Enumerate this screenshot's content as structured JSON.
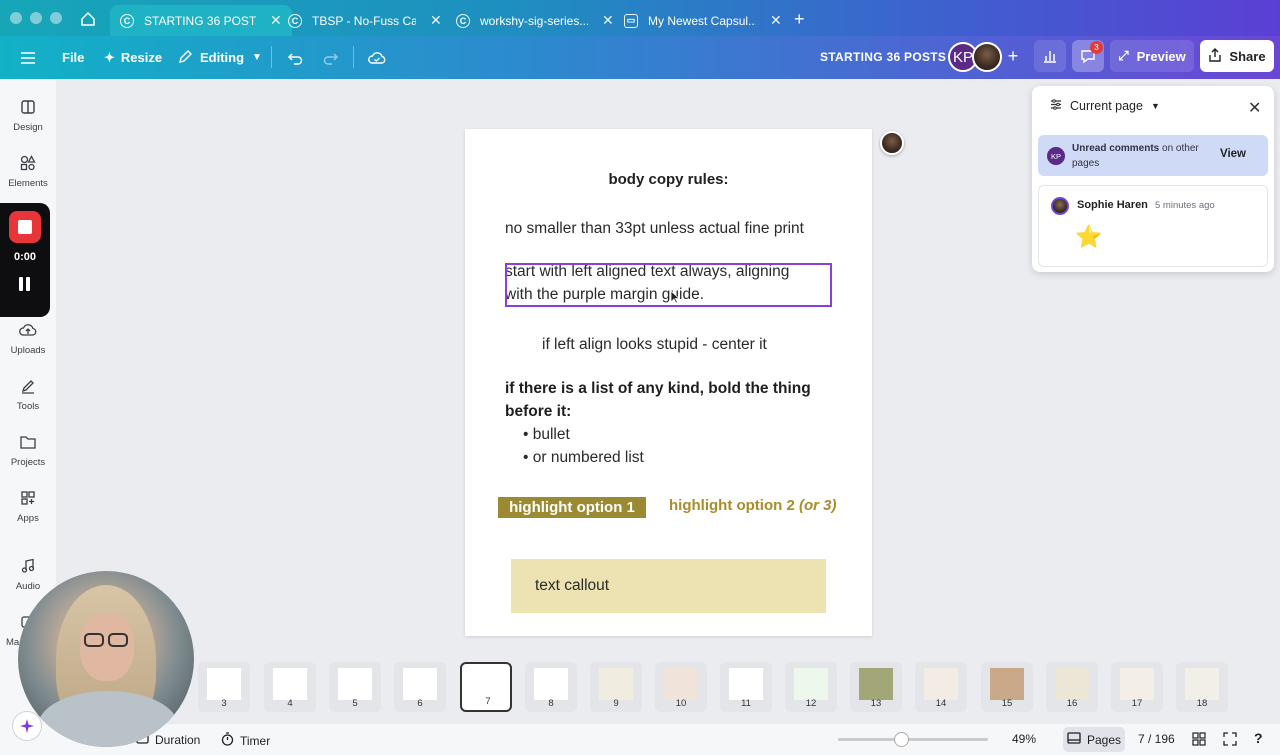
{
  "tabs": [
    {
      "label": "STARTING 36 POST...",
      "icon": "canva-icon"
    },
    {
      "label": "TBSP - No-Fuss Ca...",
      "icon": "canva-icon"
    },
    {
      "label": "workshy-sig-series...",
      "icon": "canva-icon"
    },
    {
      "label": "My Newest Capsul...",
      "icon": "chat-icon"
    }
  ],
  "toolbar": {
    "file_label": "File",
    "resize_label": "Resize",
    "editing_label": "Editing",
    "doc_title": "STARTING 36 POSTS",
    "avatar_initials": "KP",
    "comments_badge": "3",
    "preview_label": "Preview",
    "share_label": "Share"
  },
  "sidebar": {
    "items": [
      {
        "label": "Design",
        "icon": "design-icon"
      },
      {
        "label": "Elements",
        "icon": "elements-icon"
      },
      {
        "label": "Uploads",
        "icon": "uploads-icon"
      },
      {
        "label": "Tools",
        "icon": "tools-icon"
      },
      {
        "label": "Projects",
        "icon": "projects-icon"
      },
      {
        "label": "Apps",
        "icon": "apps-icon"
      },
      {
        "label": "Audio",
        "icon": "audio-icon"
      },
      {
        "label": "Ma",
        "icon": "magic-icon"
      }
    ]
  },
  "recorder": {
    "time": "0:00"
  },
  "page": {
    "heading": "body copy rules:",
    "line1": "no smaller than 33pt unless actual fine print",
    "line2a": "start with left aligned text always, aligning",
    "line2b": "with the purple margin guide.",
    "line3": "if left align looks stupid - center it",
    "list_intro_a": "if there is a list of any kind, bold the thing",
    "list_intro_b": "before it:",
    "bullets": [
      "• bullet",
      "• or numbered list"
    ],
    "highlight1": "highlight option 1",
    "highlight2_main": "highlight option 2 ",
    "highlight2_alt": "(or 3)",
    "callout": "text callout"
  },
  "comments_panel": {
    "filter_label": "Current page",
    "unread_bold": "Unread comments",
    "unread_rest": " on other pages",
    "unread_initials": "KP",
    "view_label": "View",
    "comment_author": "Sophie Haren",
    "comment_time": "5 minutes ago",
    "comment_body": "⭐"
  },
  "page_strip": {
    "pages": [
      "3",
      "4",
      "5",
      "6",
      "7",
      "8",
      "9",
      "10",
      "11",
      "12",
      "13",
      "14",
      "15",
      "16",
      "17",
      "18"
    ],
    "active": "7"
  },
  "bottom_bar": {
    "duration_label": "Duration",
    "timer_label": "Timer",
    "zoom": "49%",
    "pages_label": "Pages",
    "page_count": "7 / 196",
    "help": "?"
  }
}
